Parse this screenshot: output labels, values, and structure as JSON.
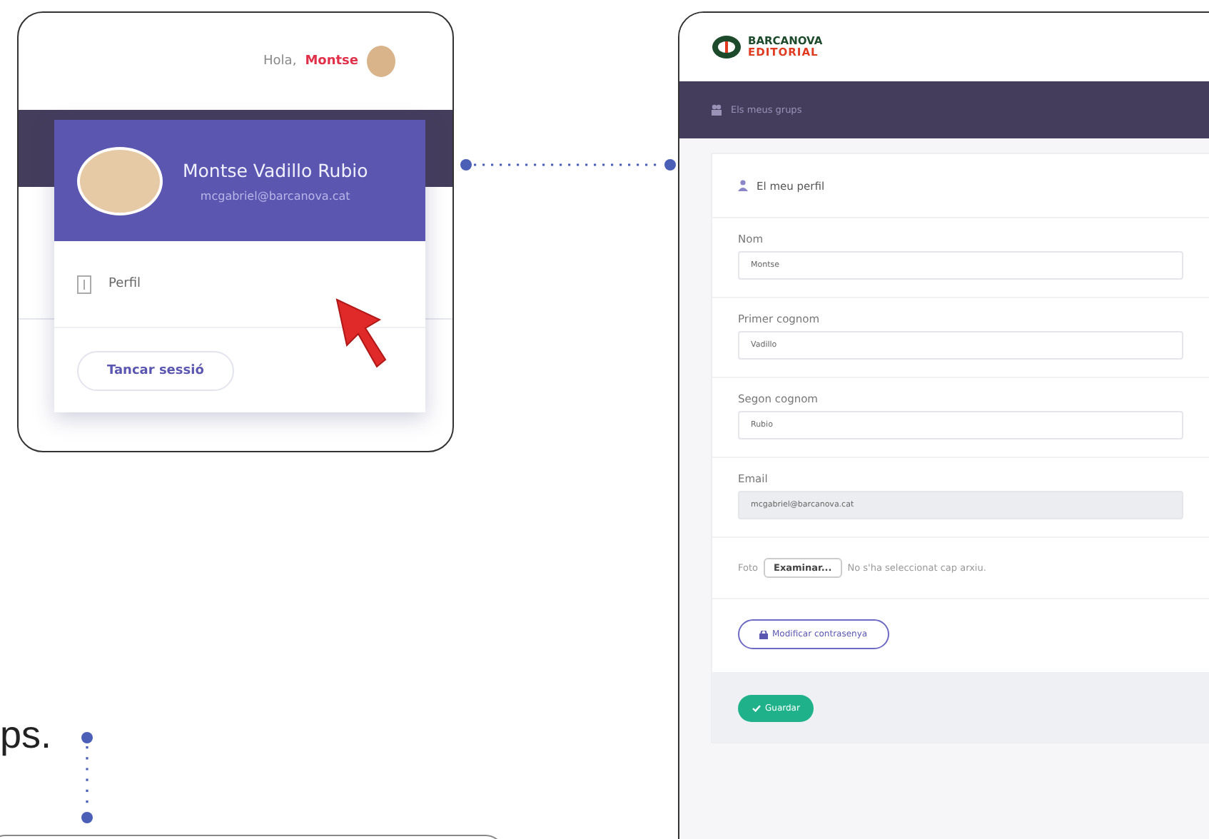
{
  "profile_menu": {
    "greeting": "Hola,",
    "user_name": "Montse",
    "full_name": "Montse Vadillo Rubio",
    "email": "mcgabriel@barcanova.cat",
    "items": [
      "Perfil"
    ],
    "logout_button": "Tancar sessió"
  },
  "profile_form": {
    "logo": [
      "BARCANOVA",
      "EDITORIAL"
    ],
    "nav_item": "Els meus grups",
    "title": "El meu perfil",
    "fields": [
      {
        "label": "Nom",
        "value": "Montse",
        "disabled": false
      },
      {
        "label": "Primer cognom",
        "value": "Vadillo",
        "disabled": false
      },
      {
        "label": "Segon cognom",
        "value": "Rubio",
        "disabled": false
      },
      {
        "label": "Email",
        "value": "mcgabriel@barcanova.cat",
        "disabled": true
      }
    ],
    "photo": {
      "label": "Foto",
      "button": "Examinar...",
      "status": "No s'ha seleccionat cap arxiu."
    },
    "change_password_button": "Modificar contrasenya",
    "save_button": "Guardar"
  },
  "body_text": "ps."
}
